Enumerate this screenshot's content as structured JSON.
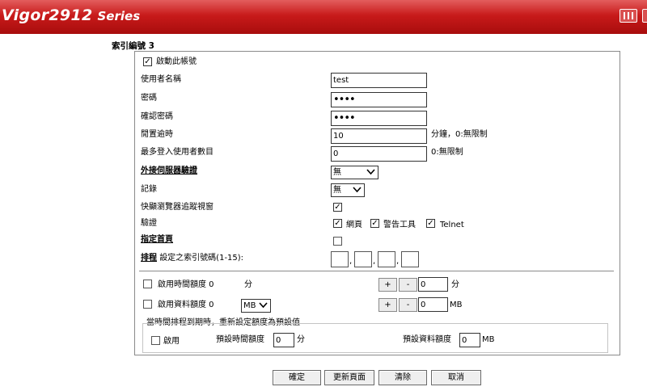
{
  "header": {
    "model": "Vigor2912",
    "series": "Series"
  },
  "index_label": "索引編號 3",
  "form": {
    "enable_account": {
      "label": "啟動此帳號",
      "checked": true
    },
    "username": {
      "label": "使用者名稱",
      "value": "test"
    },
    "password": {
      "label": "密碼",
      "value": "••••"
    },
    "confirm_password": {
      "label": "確認密碼",
      "value": "••••"
    },
    "idle_timeout": {
      "label": "閒置逾時",
      "value": "10",
      "unit": "分鐘，0:無限制"
    },
    "max_login_users": {
      "label": "最多登入使用者數目",
      "value": "0",
      "unit": "0:無限制"
    },
    "external_server_auth": {
      "label": "外接伺服器驗證",
      "value": "無"
    },
    "log": {
      "label": "記錄",
      "value": "無"
    },
    "popup_tracking": {
      "label": "快顯瀏覽器追蹤視窗",
      "checked": true
    },
    "authentication": {
      "label": "驗證",
      "options": [
        {
          "label": "網頁",
          "checked": true
        },
        {
          "label": "警告工具",
          "checked": true
        },
        {
          "label": "Telnet",
          "checked": true
        }
      ]
    },
    "landing_page": {
      "label": "指定首頁",
      "checked": false
    },
    "schedule": {
      "label": "排程",
      "suffix": "設定之索引號碼(1-15):",
      "comma": ","
    },
    "time_quota": {
      "label": "啟用時間額度 0",
      "unit_label": "分",
      "value": "0",
      "unit": "分",
      "plus": "+",
      "minus": "-"
    },
    "data_quota": {
      "label": "啟用資料額度 0",
      "select_value": "MB",
      "value": "0",
      "unit": "MB",
      "plus": "+",
      "minus": "-"
    },
    "reset_section": {
      "title": "當時間排程到期時，重新設定額度為預設值",
      "enable_label": "啟用",
      "default_time_label": "預設時間額度",
      "default_time_value": "0",
      "default_time_unit": "分",
      "default_data_label": "預設資料額度",
      "default_data_value": "0",
      "default_data_unit": "MB"
    }
  },
  "buttons": {
    "ok": "確定",
    "refresh": "更新頁面",
    "clear": "清除",
    "cancel": "取消"
  }
}
